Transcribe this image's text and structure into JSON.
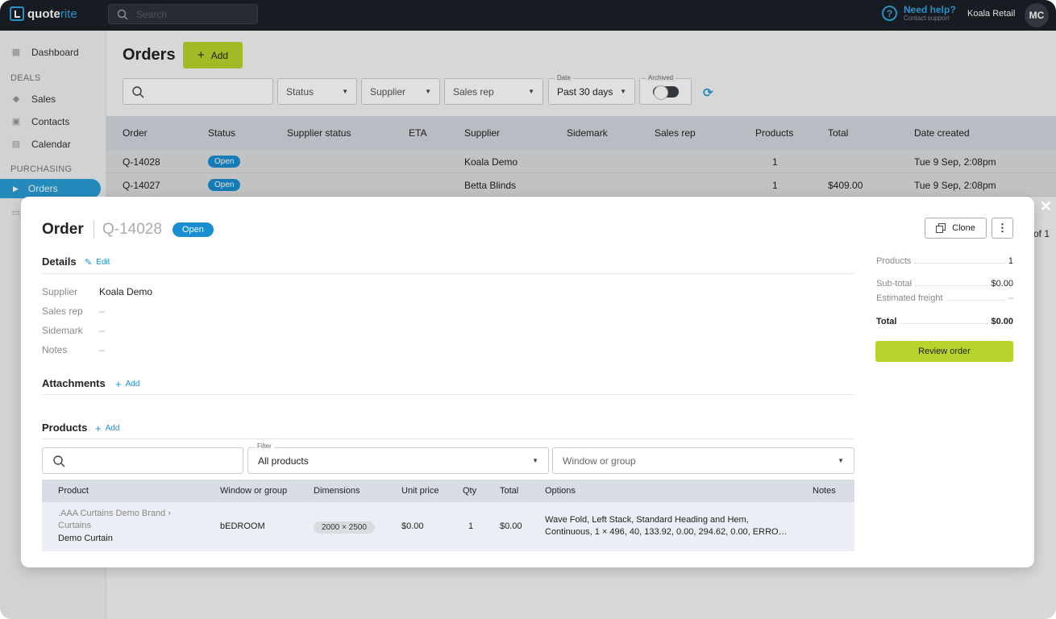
{
  "app": {
    "brand_left": "quote",
    "brand_right": "rite",
    "search_placeholder": "Search"
  },
  "help": {
    "title": "Need help?",
    "subtitle": "Contact support"
  },
  "account": {
    "company": "Koala Retail",
    "initials": "MC"
  },
  "sidebar": {
    "dashboard": "Dashboard",
    "deals_heading": "DEALS",
    "sales": "Sales",
    "contacts": "Contacts",
    "calendar": "Calendar",
    "purchasing_heading": "PURCHASING",
    "orders": "Orders"
  },
  "page": {
    "title": "Orders",
    "add_label": "Add"
  },
  "filters": {
    "status": "Status",
    "supplier": "Supplier",
    "sales_rep": "Sales rep",
    "date_label": "Date",
    "date_value": "Past 30 days",
    "archived_label": "Archived"
  },
  "table": {
    "headers": [
      "Order",
      "Status",
      "Supplier status",
      "ETA",
      "Supplier",
      "Sidemark",
      "Sales rep",
      "Products",
      "Total",
      "Date created"
    ],
    "rows": [
      {
        "order": "Q-14028",
        "status": "Open",
        "supplier": "Koala Demo",
        "products": "1",
        "total": "",
        "date": "Tue 9 Sep, 2:08pm"
      },
      {
        "order": "Q-14027",
        "status": "Open",
        "supplier": "Betta Blinds",
        "products": "1",
        "total": "$409.00",
        "date": "Tue 9 Sep, 2:08pm"
      }
    ]
  },
  "overlay": {
    "esc": "esc",
    "pager": "of 1"
  },
  "modal": {
    "title": "Order",
    "order_id": "Q-14028",
    "status": "Open",
    "clone_label": "Clone",
    "details": {
      "heading": "Details",
      "edit_label": "Edit",
      "supplier_label": "Supplier",
      "supplier_value": "Koala Demo",
      "sales_rep_label": "Sales rep",
      "sales_rep_value": "–",
      "sidemark_label": "Sidemark",
      "sidemark_value": "–",
      "notes_label": "Notes",
      "notes_value": "–"
    },
    "attachments": {
      "heading": "Attachments",
      "add_label": "Add"
    },
    "products": {
      "heading": "Products",
      "add_label": "Add",
      "filter_label": "Filter",
      "filter_value": "All products",
      "group_placeholder": "Window or group",
      "headers": [
        "Product",
        "Window or group",
        "Dimensions",
        "Unit price",
        "Qty",
        "Total",
        "Options",
        "Notes"
      ],
      "row": {
        "path": ".AAA Curtains Demo Brand  ›",
        "category": "Curtains",
        "name": "Demo Curtain",
        "window": "bEDROOM",
        "dimensions": "2000 × 2500",
        "unit_price": "$0.00",
        "qty": "1",
        "total": "$0.00",
        "options_line1": "Wave Fold, Left Stack, Standard Heading and Hem,",
        "options_line2": "Continuous, 1 × 496, 40, 133.92, 0.00, 294.62, 0.00, ERRO…"
      }
    },
    "summary": {
      "products_label": "Products",
      "products_value": "1",
      "subtotal_label": "Sub-total",
      "subtotal_value": "$0.00",
      "freight_label": "Estimated freight",
      "freight_value": "–",
      "total_label": "Total",
      "total_value": "$0.00",
      "review_label": "Review order"
    }
  }
}
